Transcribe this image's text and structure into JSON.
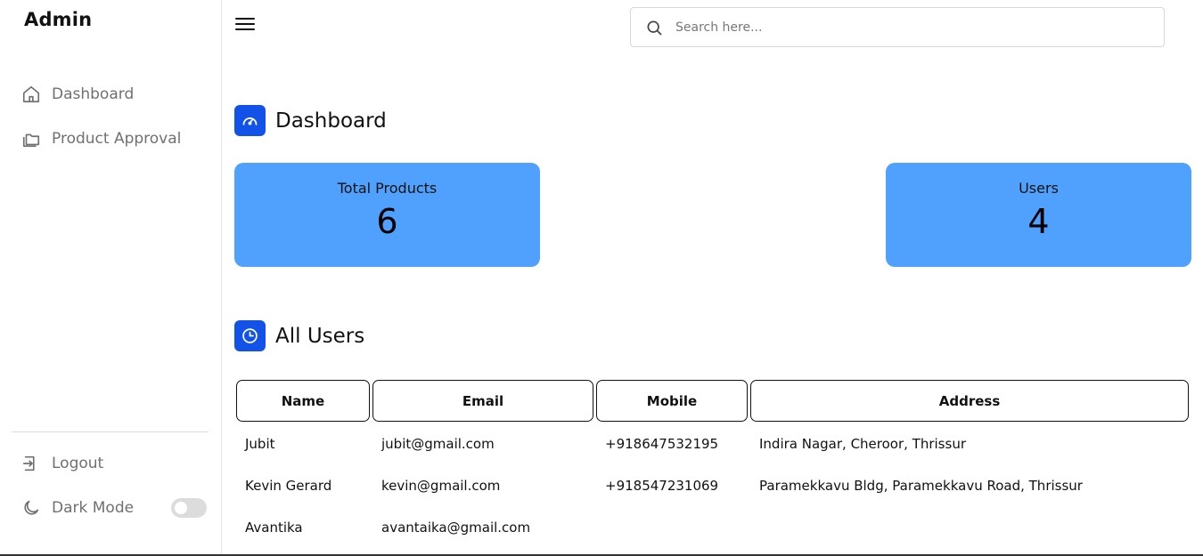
{
  "sidebar": {
    "brand": "Admin",
    "items": [
      {
        "label": "Dashboard",
        "icon": "home-icon"
      },
      {
        "label": "Product Approval",
        "icon": "folders-icon"
      }
    ],
    "logout_label": "Logout",
    "dark_mode_label": "Dark Mode",
    "dark_mode_on": false
  },
  "topbar": {
    "menu_icon": "hamburger-icon",
    "search_placeholder": "Search here...",
    "search_value": ""
  },
  "dashboard": {
    "title": "Dashboard",
    "cards": [
      {
        "label": "Total Products",
        "value": "6"
      },
      {
        "label": "Users",
        "value": "4"
      }
    ]
  },
  "users": {
    "title": "All Users",
    "columns": [
      "Name",
      "Email",
      "Mobile",
      "Address"
    ],
    "rows": [
      {
        "name": "Jubit",
        "email": "jubit@gmail.com",
        "mobile": "+918647532195",
        "address": "Indira Nagar, Cheroor, Thrissur"
      },
      {
        "name": "Kevin Gerard",
        "email": "kevin@gmail.com",
        "mobile": "+918547231069",
        "address": "Paramekkavu Bldg, Paramekkavu Road, Thrissur"
      },
      {
        "name": "Avantika",
        "email": "avantaika@gmail.com",
        "mobile": "",
        "address": ""
      }
    ]
  },
  "colors": {
    "accent": "#1352e8",
    "card": "#4fa1fd",
    "muted_text": "#707070"
  }
}
